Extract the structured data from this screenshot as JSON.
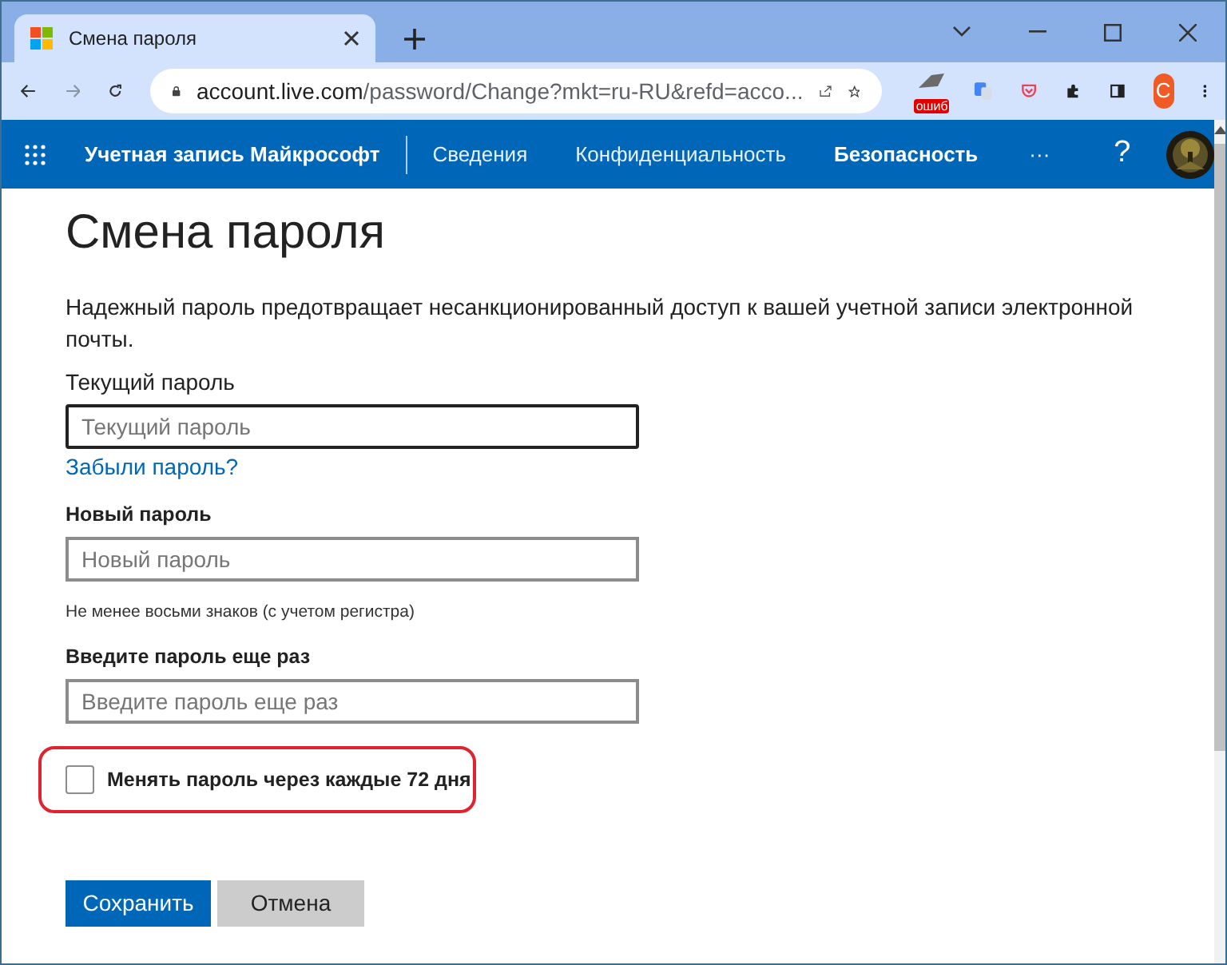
{
  "browser": {
    "tab": {
      "title": "Смена пароля"
    },
    "url": {
      "domain": "account.live.com",
      "path": "/password/Change?mkt=ru-RU&refd=acco..."
    },
    "extension_badge": "ошиб",
    "profile_initial": "C"
  },
  "nav": {
    "brand": "Учетная запись Майкрософт",
    "items": [
      {
        "label": "Сведения",
        "selected": false
      },
      {
        "label": "Конфиденциальность",
        "selected": false
      },
      {
        "label": "Безопасность",
        "selected": true
      }
    ],
    "more": "···",
    "help": "?"
  },
  "page": {
    "title": "Смена пароля",
    "intro": "Надежный пароль предотвращает несанкционированный доступ к вашей учетной записи электронной почты.",
    "fields": [
      {
        "label": "Текущий пароль",
        "placeholder": "Текущий пароль",
        "focused": true,
        "bold_label": false,
        "link": "Забыли пароль?"
      },
      {
        "label": "Новый пароль",
        "placeholder": "Новый пароль",
        "focused": false,
        "bold_label": true,
        "hint": "Не менее восьми знаков (с учетом регистра)"
      },
      {
        "label": "Введите пароль еще раз",
        "placeholder": "Введите пароль еще раз",
        "focused": false,
        "bold_label": true
      }
    ],
    "expire": {
      "label": "Менять пароль через каждые 72 дня",
      "checked": false,
      "highlighted": true
    },
    "buttons": [
      {
        "label": "Сохранить",
        "kind": "primary"
      },
      {
        "label": "Отмена",
        "kind": "secondary"
      }
    ]
  }
}
